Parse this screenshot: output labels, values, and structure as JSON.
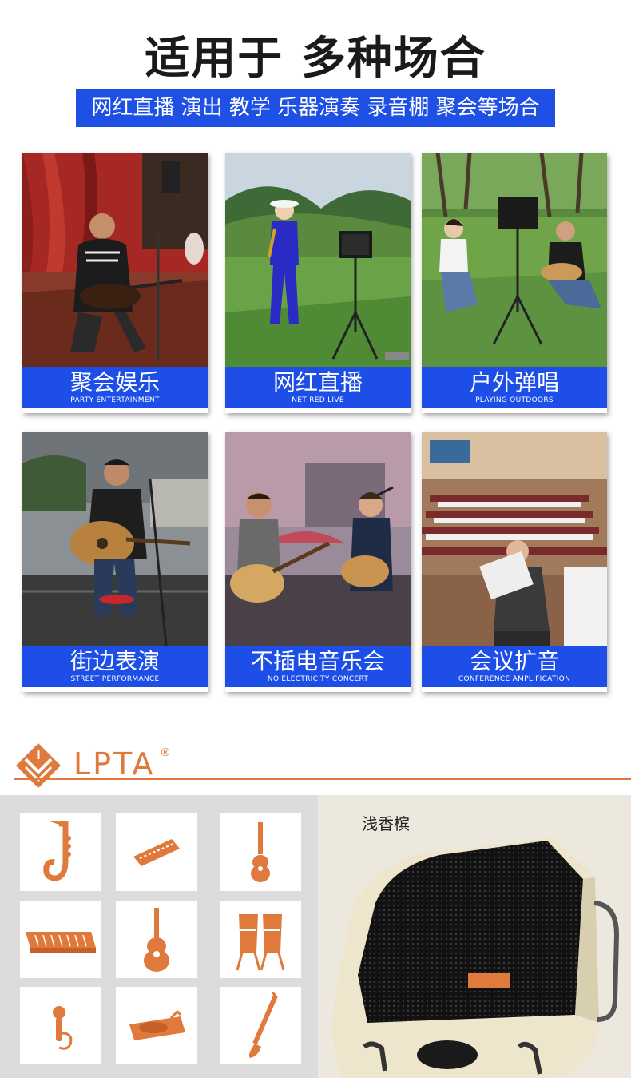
{
  "heading": "适用于 多种场合",
  "banner": "网红直播 演出 教学 乐器演奏 录音棚 聚会等场合",
  "scenes": [
    {
      "cn": "聚会娱乐",
      "en": "PARTY ENTERTAINMENT"
    },
    {
      "cn": "网红直播",
      "en": "NET RED LIVE"
    },
    {
      "cn": "户外弹唱",
      "en": "PLAYING OUTDOORS"
    },
    {
      "cn": "街边表演",
      "en": "STREET PERFORMANCE"
    },
    {
      "cn": "不插电音乐会",
      "en": "NO ELECTRICITY CONCERT"
    },
    {
      "cn": "会议扩音",
      "en": "CONFERENCE AMPLIFICATION"
    }
  ],
  "brand": {
    "name": "LPTA",
    "registered": "®",
    "color": "#e07a3c"
  },
  "instruments": [
    "saxophone-icon",
    "harmonica-icon",
    "ukulele-icon",
    "keyboard-icon",
    "acoustic-guitar-icon",
    "conga-drums-icon",
    "microphone-icon",
    "turntable-icon",
    "clarinet-icon"
  ],
  "speaker": {
    "color_name": "浅香槟"
  }
}
